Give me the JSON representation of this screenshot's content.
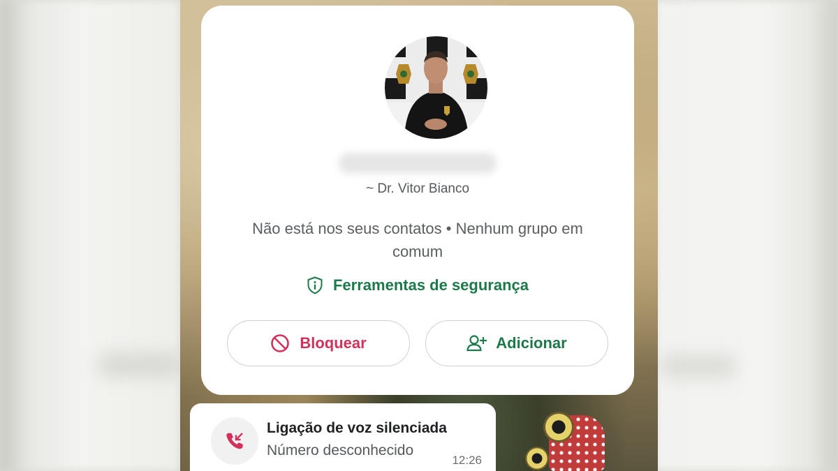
{
  "contact_card": {
    "nickname": "~ Dr. Vitor Bianco",
    "info": "Não está nos seus contatos • Nenhum grupo em comum",
    "safety_tools_label": "Ferramentas de segurança",
    "block_label": "Bloquear",
    "add_label": "Adicionar",
    "avatar_icon": "profile-photo",
    "safety_icon": "shield-info-icon",
    "block_icon": "block-circle-icon",
    "add_icon": "add-person-icon"
  },
  "call_message": {
    "title": "Ligação de voz silenciada",
    "subtitle": "Número desconhecido",
    "time": "12:26",
    "icon": "missed-call-icon"
  },
  "colors": {
    "accent_green": "#1c7a4a",
    "danger_red": "#d1315a"
  }
}
